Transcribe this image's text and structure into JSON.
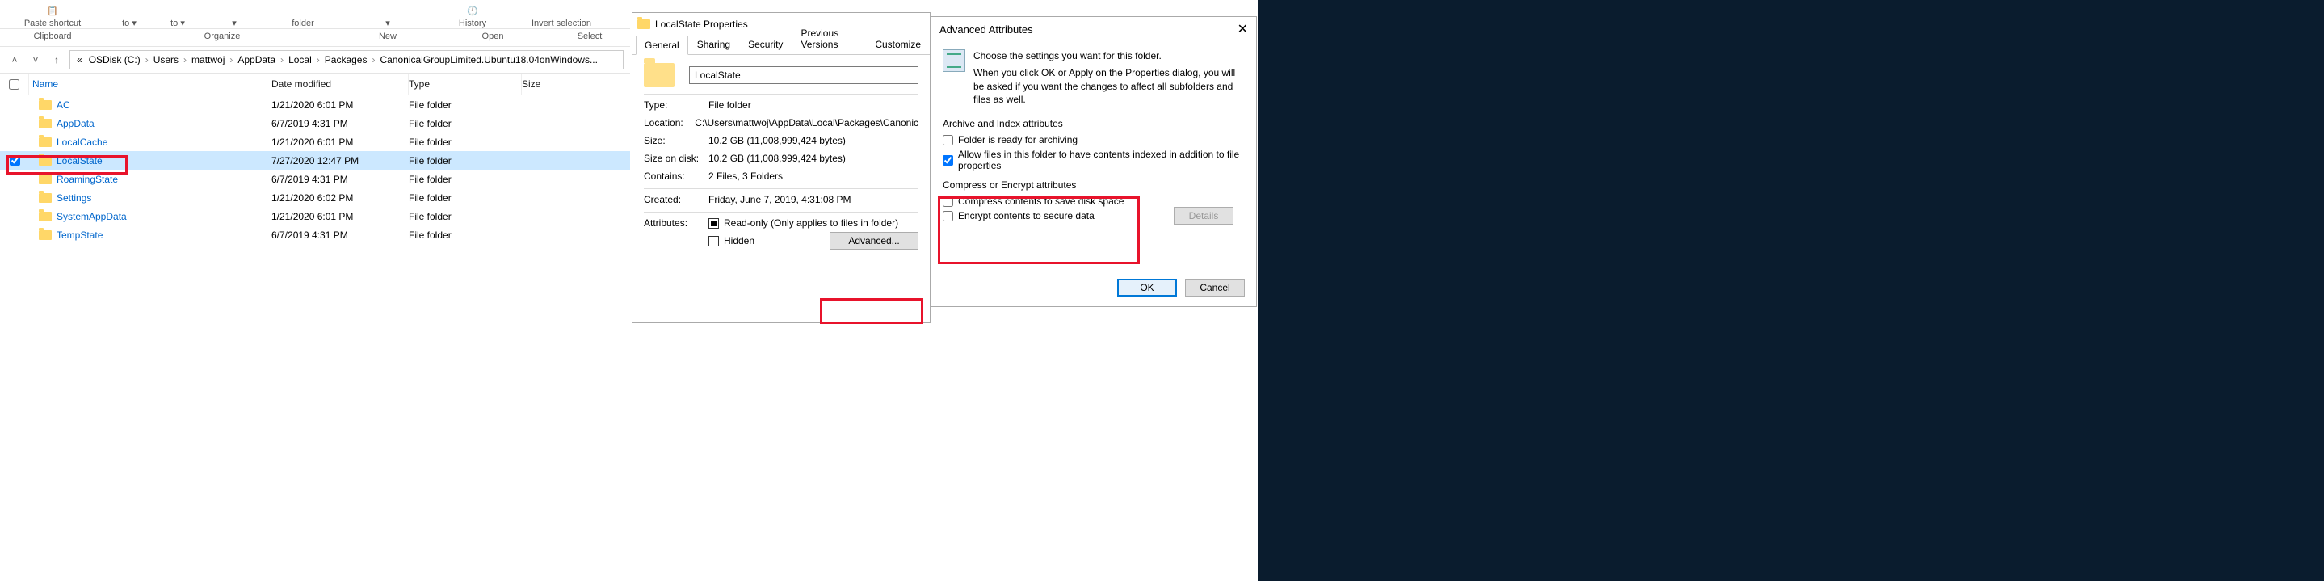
{
  "ribbon": {
    "paste_shortcut": "Paste shortcut",
    "to1": "to ▾",
    "to2": "to ▾",
    "folder": "folder",
    "history": "History",
    "invert": "Invert selection",
    "groups": {
      "clipboard": "Clipboard",
      "organize": "Organize",
      "new": "New",
      "open": "Open",
      "select": "Select"
    }
  },
  "breadcrumb": [
    "«",
    "OSDisk (C:)",
    "Users",
    "mattwoj",
    "AppData",
    "Local",
    "Packages",
    "CanonicalGroupLimited.Ubuntu18.04onWindows..."
  ],
  "columns": {
    "name": "Name",
    "date": "Date modified",
    "type": "Type",
    "size": "Size"
  },
  "rows": [
    {
      "name": "AC",
      "date": "1/21/2020 6:01 PM",
      "type": "File folder",
      "selected": false
    },
    {
      "name": "AppData",
      "date": "6/7/2019 4:31 PM",
      "type": "File folder",
      "selected": false
    },
    {
      "name": "LocalCache",
      "date": "1/21/2020 6:01 PM",
      "type": "File folder",
      "selected": false
    },
    {
      "name": "LocalState",
      "date": "7/27/2020 12:47 PM",
      "type": "File folder",
      "selected": true
    },
    {
      "name": "RoamingState",
      "date": "6/7/2019 4:31 PM",
      "type": "File folder",
      "selected": false
    },
    {
      "name": "Settings",
      "date": "1/21/2020 6:02 PM",
      "type": "File folder",
      "selected": false
    },
    {
      "name": "SystemAppData",
      "date": "1/21/2020 6:01 PM",
      "type": "File folder",
      "selected": false
    },
    {
      "name": "TempState",
      "date": "6/7/2019 4:31 PM",
      "type": "File folder",
      "selected": false
    }
  ],
  "properties": {
    "title": "LocalState Properties",
    "tabs": [
      "General",
      "Sharing",
      "Security",
      "Previous Versions",
      "Customize"
    ],
    "name_value": "LocalState",
    "type_label": "Type:",
    "type_value": "File folder",
    "location_label": "Location:",
    "location_value": "C:\\Users\\mattwoj\\AppData\\Local\\Packages\\Canonic",
    "size_label": "Size:",
    "size_value": "10.2 GB (11,008,999,424 bytes)",
    "sizeondisk_label": "Size on disk:",
    "sizeondisk_value": "10.2 GB (11,008,999,424 bytes)",
    "contains_label": "Contains:",
    "contains_value": "2 Files, 3 Folders",
    "created_label": "Created:",
    "created_value": "Friday, June 7, 2019, 4:31:08 PM",
    "attributes_label": "Attributes:",
    "readonly_label": "Read-only (Only applies to files in folder)",
    "hidden_label": "Hidden",
    "advanced_btn": "Advanced..."
  },
  "advanced": {
    "title": "Advanced Attributes",
    "desc1": "Choose the settings you want for this folder.",
    "desc2": "When you click OK or Apply on the Properties dialog, you will be asked if you want the changes to affect all subfolders and files as well.",
    "archive_section": "Archive and Index attributes",
    "archive_ready": "Folder is ready for archiving",
    "allow_index": "Allow files in this folder to have contents indexed in addition to file properties",
    "compress_section": "Compress or Encrypt attributes",
    "compress": "Compress contents to save disk space",
    "encrypt": "Encrypt contents to secure data",
    "details": "Details",
    "ok": "OK",
    "cancel": "Cancel"
  }
}
